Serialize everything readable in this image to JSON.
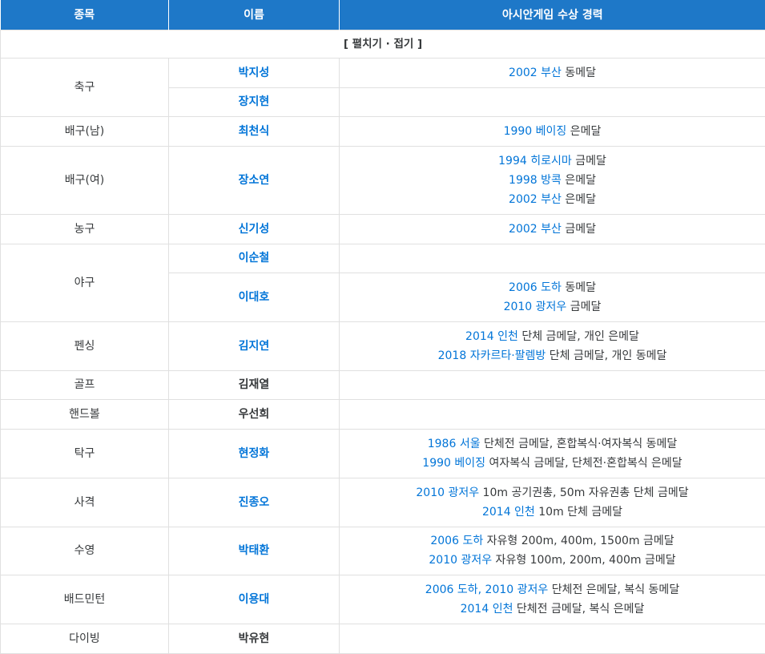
{
  "headers": [
    "종목",
    "이름",
    "아시안게임 수상 경력"
  ],
  "fold_label": "[ 펼치기 · 접기 ]",
  "sports": {
    "football": "축구",
    "volleyball_m": "배구(남)",
    "volleyball_w": "배구(여)",
    "basketball": "농구",
    "baseball": "야구",
    "fencing": "펜싱",
    "golf": "골프",
    "handball": "핸드볼",
    "tabletennis": "탁구",
    "shooting": "사격",
    "swimming": "수영",
    "badminton": "배드민턴",
    "diving": "다이빙"
  },
  "names": {
    "park_jisung": "박지성",
    "jang_jihyun": "장지현",
    "choi_cheonsik": "최천식",
    "jang_soyeon": "장소연",
    "shin_kisung": "신기성",
    "lee_soonchul": "이순철",
    "lee_daeho": "이대호",
    "kim_jiyeon": "김지연",
    "kim_jaeyeol": "김재열",
    "woo_sunhee": "우선희",
    "hyun_junghwa": "현정화",
    "jin_jongoh": "진종오",
    "park_taehwan": "박태환",
    "lee_yongdae": "이용대",
    "park_yuhyun": "박유현"
  },
  "awards": {
    "park_jisung": [
      {
        "link": "2002 부산",
        "text": " 동메달"
      }
    ],
    "choi_cheonsik": [
      {
        "link": "1990 베이징",
        "text": " 은메달"
      }
    ],
    "jang_soyeon": [
      {
        "link": "1994 히로시마",
        "text": " 금메달"
      },
      {
        "link": "1998 방콕",
        "text": " 은메달"
      },
      {
        "link": "2002 부산",
        "text": " 은메달"
      }
    ],
    "shin_kisung": [
      {
        "link": "2002 부산",
        "text": " 금메달"
      }
    ],
    "lee_daeho": [
      {
        "link": "2006 도하",
        "text": " 동메달"
      },
      {
        "link": "2010 광저우",
        "text": " 금메달"
      }
    ],
    "kim_jiyeon": [
      {
        "link": "2014 인천",
        "text": " 단체 금메달, 개인 은메달"
      },
      {
        "link": "2018 자카르타·팔렘방",
        "text": " 단체 금메달, 개인 동메달"
      }
    ],
    "hyun_junghwa": [
      {
        "link": "1986 서울",
        "text": " 단체전 금메달, 혼합복식·여자복식 동메달"
      },
      {
        "link": "1990 베이징",
        "text": " 여자복식 금메달, 단체전·혼합복식 은메달"
      }
    ],
    "jin_jongoh": [
      {
        "link": "2010 광저우",
        "text": " 10m 공기권총, 50m 자유권총 단체 금메달"
      },
      {
        "link": "2014 인천",
        "text": " 10m 단체 금메달"
      }
    ],
    "park_taehwan": [
      {
        "link": "2006 도하",
        "text": " 자유형 200m, 400m, 1500m 금메달"
      },
      {
        "link": "2010 광저우",
        "text": " 자유형 100m, 200m, 400m 금메달"
      }
    ],
    "lee_yongdae": [
      {
        "link": "2006 도하",
        "text": ", ",
        "link2": "2010 광저우",
        "text2": " 단체전 은메달, 복식 동메달"
      },
      {
        "link": "2014 인천",
        "text": " 단체전 금메달, 복식 은메달"
      }
    ]
  }
}
